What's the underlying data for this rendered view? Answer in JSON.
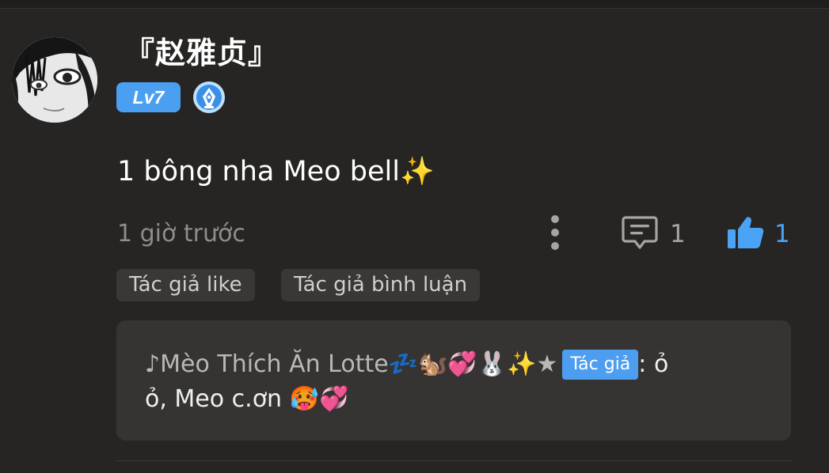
{
  "user": {
    "name": "『赵雅贞』",
    "level_badge": "Lv7",
    "avatar_icon": "avatar-image",
    "medal_icon": "pen-nib-medal-icon"
  },
  "comment": {
    "text": "1 bông nha Meo bell✨",
    "timestamp": "1 giờ trước",
    "reply_count": "1",
    "like_count": "1"
  },
  "tags": [
    "Tác giả like",
    "Tác giả bình luận"
  ],
  "reply": {
    "author": "♪Mèo Thích Ăn Lotte💤🐿️💞🐰✨★",
    "author_badge": "Tác giả",
    "text_part1": ": ỏ",
    "text_part2": "ỏ, Meo c.ơn 🥵💞"
  },
  "colors": {
    "background": "#262523",
    "accent": "#4aa3f3",
    "tag_bg": "#393836",
    "reply_bg": "#353433"
  }
}
